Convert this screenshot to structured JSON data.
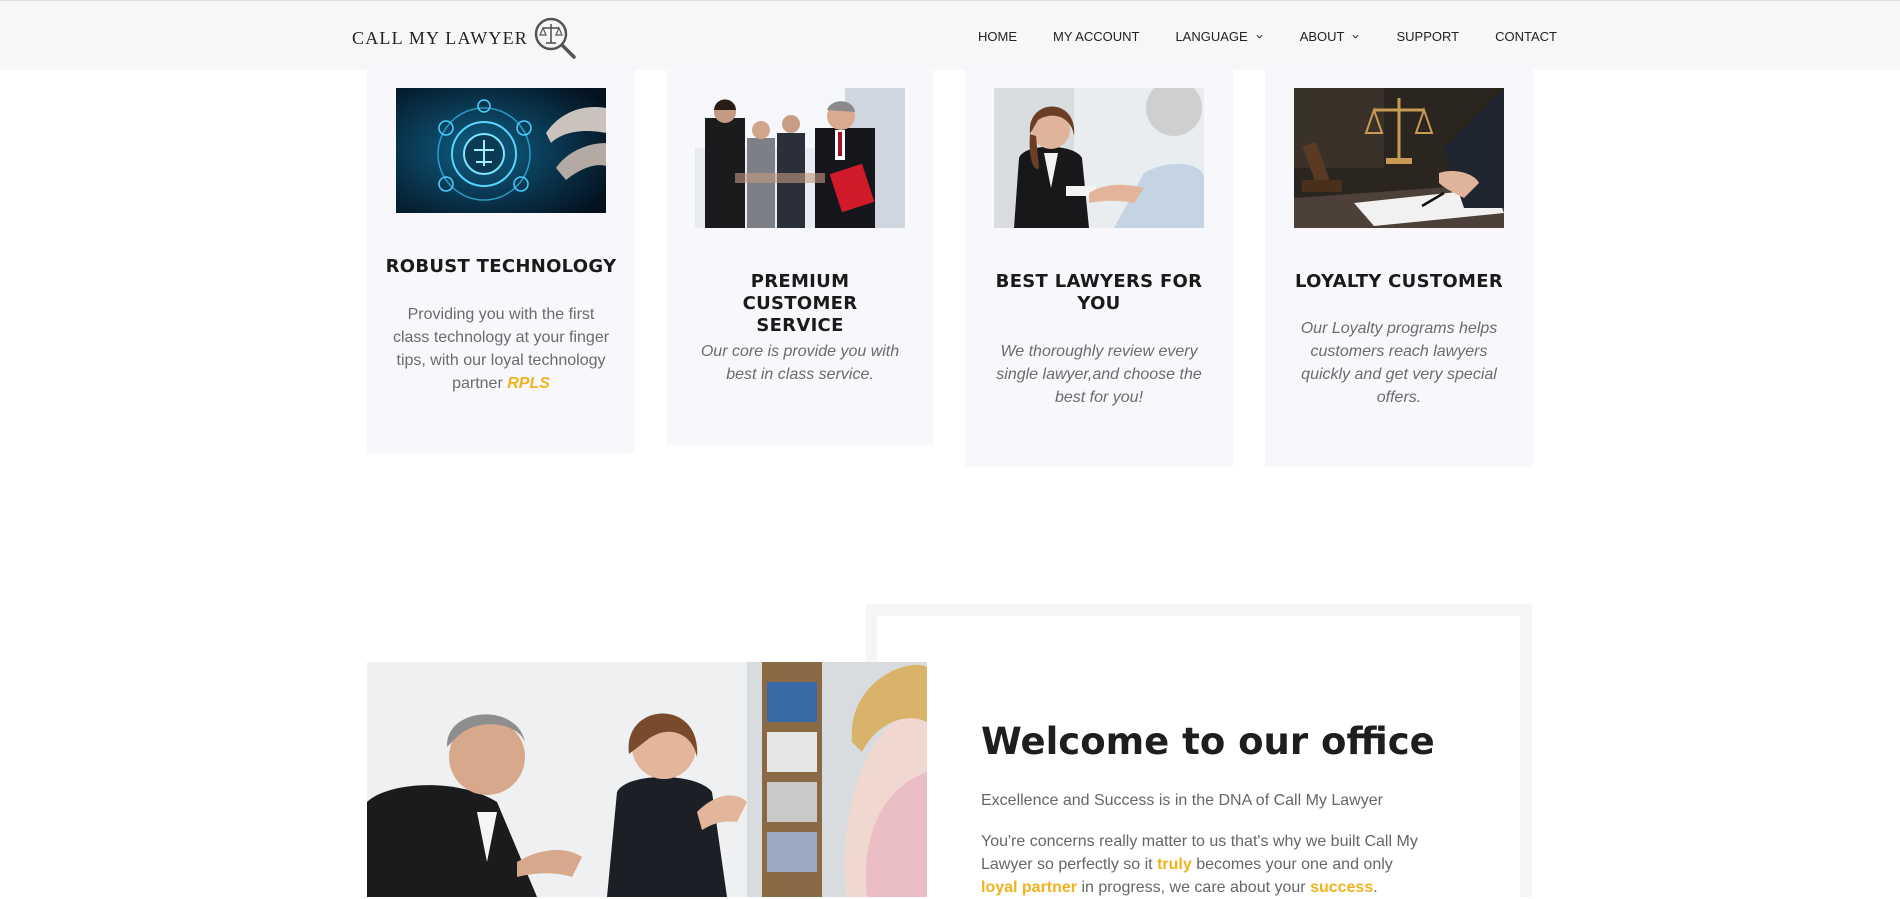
{
  "brand": {
    "name": "CALL MY LAWYER",
    "logo_icon": "scales-magnifier-icon"
  },
  "nav": {
    "items": [
      {
        "label": "HOME",
        "dropdown": false
      },
      {
        "label": "MY ACCOUNT",
        "dropdown": false
      },
      {
        "label": "LANGUAGE",
        "dropdown": true
      },
      {
        "label": "ABOUT",
        "dropdown": true
      },
      {
        "label": "SUPPORT",
        "dropdown": false
      },
      {
        "label": "CONTACT",
        "dropdown": false
      }
    ]
  },
  "features": [
    {
      "title": "ROBUST TECHNOLOGY",
      "text": "Providing you with the first class technology at your finger tips, with our loyal technology partner",
      "highlight": "RPLS"
    },
    {
      "title": "PREMIUM CUSTOMER SERVICE",
      "text": "Our core is provide you with best in class service."
    },
    {
      "title": "BEST LAWYERS FOR YOU",
      "text": "We thoroughly review every single lawyer,and choose the best for you!"
    },
    {
      "title": "LOYALTY CUSTOMER",
      "text": "Our Loyalty programs helps customers reach lawyers quickly and get very special offers."
    }
  ],
  "office": {
    "title": "Welcome to our office",
    "subtitle": "Excellence and Success is in the DNA of Call My Lawyer",
    "body": {
      "p1": "You're concerns really matter to us that's why we built Call My Lawyer so perfectly so it",
      "h1": "truly",
      "p2": "becomes your one and only",
      "h2": "loyal partner",
      "p3": "in progress, we care about your",
      "h3": "success",
      "p4": "."
    }
  },
  "colors": {
    "accent": "#f0b31d",
    "card_bg": "#f8f8fc",
    "header_bg": "#f7f7fa"
  }
}
